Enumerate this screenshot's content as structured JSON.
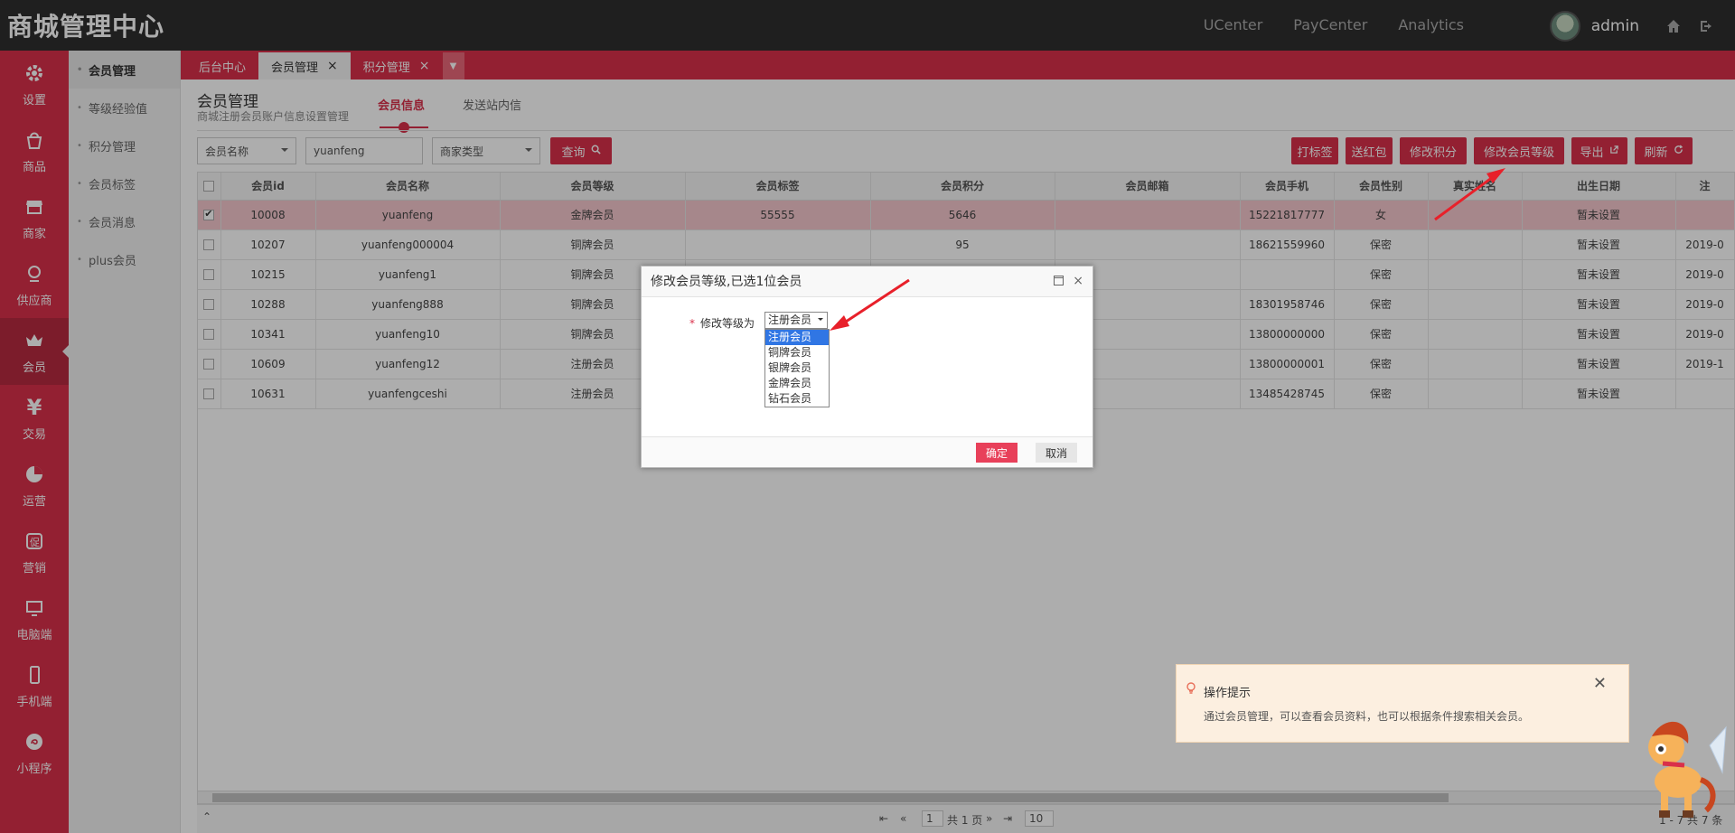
{
  "header": {
    "brand": "商城管理中心",
    "links": [
      "UCenter",
      "PayCenter",
      "Analytics"
    ],
    "username": "admin"
  },
  "sidebar": {
    "items": [
      {
        "label": "设置",
        "icon": "gear-icon"
      },
      {
        "label": "商品",
        "icon": "shopping-bag-icon"
      },
      {
        "label": "商家",
        "icon": "store-icon"
      },
      {
        "label": "供应商",
        "icon": "award-icon"
      },
      {
        "label": "会员",
        "icon": "crown-icon"
      },
      {
        "label": "交易",
        "icon": "yen-icon"
      },
      {
        "label": "运营",
        "icon": "pie-chart-icon"
      },
      {
        "label": "营销",
        "icon": "promo-icon"
      },
      {
        "label": "电脑端",
        "icon": "monitor-icon"
      },
      {
        "label": "手机端",
        "icon": "mobile-icon"
      },
      {
        "label": "小程序",
        "icon": "mini-program-icon"
      }
    ],
    "active": "会员"
  },
  "submenu": {
    "items": [
      "会员管理",
      "等级经验值",
      "积分管理",
      "会员标签",
      "会员消息",
      "plus会员"
    ]
  },
  "tabs": {
    "items": [
      {
        "label": "后台中心",
        "closable": false
      },
      {
        "label": "会员管理",
        "closable": true
      },
      {
        "label": "积分管理",
        "closable": true
      }
    ],
    "close_glyph": "×"
  },
  "page": {
    "title": "会员管理",
    "subtitle": "商城注册会员账户信息设置管理",
    "content_tabs": [
      "会员信息",
      "发送站内信"
    ]
  },
  "filters": {
    "field_select": "会员名称",
    "keyword": "yuanfeng",
    "type_select": "商家类型",
    "search_btn": "查询"
  },
  "actions": {
    "tag": "打标签",
    "redpack": "送红包",
    "points": "修改积分",
    "level": "修改会员等级",
    "export": "导出",
    "refresh": "刷新"
  },
  "table": {
    "headers": [
      "会员id",
      "会员名称",
      "会员等级",
      "会员标签",
      "会员积分",
      "会员邮箱",
      "会员手机",
      "会员性别",
      "真实姓名",
      "出生日期",
      "注"
    ],
    "rows": [
      {
        "checked": true,
        "cells": [
          "10008",
          "yuanfeng",
          "金牌会员",
          "55555",
          "5646",
          "",
          "15221817777",
          "女",
          "",
          "暂未设置",
          ""
        ]
      },
      {
        "checked": false,
        "cells": [
          "10207",
          "yuanfeng000004",
          "铜牌会员",
          "",
          "95",
          "",
          "18621559960",
          "保密",
          "",
          "暂未设置",
          "2019-0"
        ]
      },
      {
        "checked": false,
        "cells": [
          "10215",
          "yuanfeng1",
          "铜牌会员",
          "",
          "",
          "",
          "",
          "保密",
          "",
          "暂未设置",
          "2019-0"
        ]
      },
      {
        "checked": false,
        "cells": [
          "10288",
          "yuanfeng888",
          "铜牌会员",
          "",
          "",
          "",
          "18301958746",
          "保密",
          "",
          "暂未设置",
          "2019-0"
        ]
      },
      {
        "checked": false,
        "cells": [
          "10341",
          "yuanfeng10",
          "铜牌会员",
          "",
          "",
          "",
          "13800000000",
          "保密",
          "",
          "暂未设置",
          "2019-0"
        ]
      },
      {
        "checked": false,
        "cells": [
          "10609",
          "yuanfeng12",
          "注册会员",
          "",
          "",
          "",
          "13800000001",
          "保密",
          "",
          "暂未设置",
          "2019-1"
        ]
      },
      {
        "checked": false,
        "cells": [
          "10631",
          "yuanfengceshi",
          "注册会员",
          "",
          "",
          "",
          "13485428745",
          "保密",
          "",
          "暂未设置",
          ""
        ]
      }
    ]
  },
  "pager": {
    "page": "1",
    "total_pages": "共 1 页",
    "page_size": "10",
    "summary": "1 - 7 共 7 条"
  },
  "modal": {
    "title": "修改会员等级,已选1位会员",
    "field_label": "修改等级为",
    "selected": "注册会员",
    "options": [
      "注册会员",
      "铜牌会员",
      "银牌会员",
      "金牌会员",
      "钻石会员"
    ],
    "ok": "确定",
    "cancel": "取消"
  },
  "tip": {
    "title": "操作提示",
    "text": "通过会员管理，可以查看会员资料，也可以根据条件搜索相关会员。"
  }
}
